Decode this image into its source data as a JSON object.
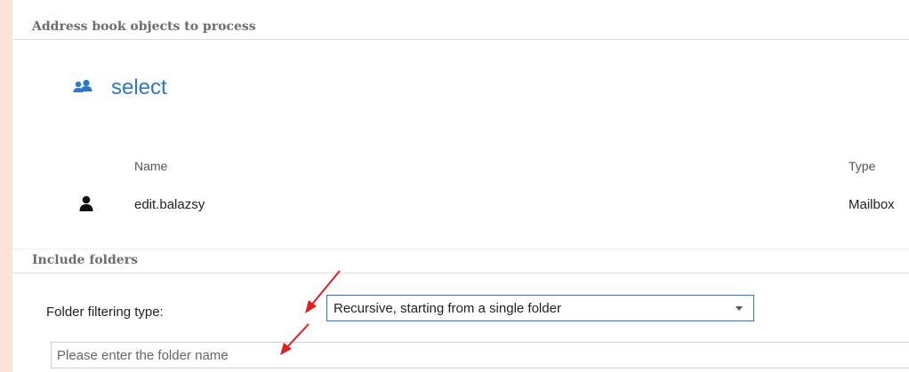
{
  "sections": {
    "objects_header": "Address book objects to process",
    "folders_header": "Include folders"
  },
  "select_action": {
    "icon": "users-icon",
    "label": "select"
  },
  "table": {
    "columns": [
      "Name",
      "Type"
    ],
    "rows": [
      {
        "icon": "user-icon",
        "name": "edit.balazsy",
        "type": "Mailbox"
      }
    ]
  },
  "folder_filter": {
    "label": "Folder filtering type:",
    "selected": "Recursive, starting from a single folder"
  },
  "folder_name": {
    "placeholder": "Please enter the folder name",
    "value": ""
  },
  "colors": {
    "accent": "#2b78c5",
    "annotation_arrow": "#e02020",
    "page_background": "#fbe4d6"
  }
}
